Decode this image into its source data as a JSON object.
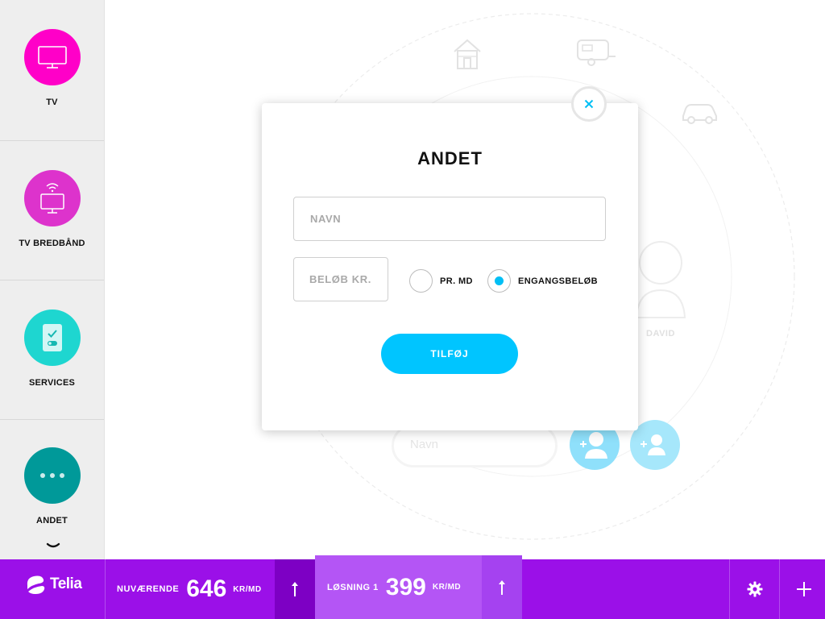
{
  "sidebar": {
    "items": [
      {
        "label": "TV",
        "icon": "tv-icon",
        "color": "#ff00c8"
      },
      {
        "label": "TV BREDBÅND",
        "icon": "wifi-tv-icon",
        "color": "#dd33cc"
      },
      {
        "label": "SERVICES",
        "icon": "phone-check-icon",
        "color": "#1ed6d0"
      },
      {
        "label": "ANDET",
        "icon": "more-icon",
        "color": "#009999"
      }
    ]
  },
  "background": {
    "name_field_placeholder": "Navn",
    "person_name": "DAVID"
  },
  "modal": {
    "title": "ANDET",
    "name_placeholder": "NAVN",
    "amount_placeholder": "BELØB KR.",
    "radio_monthly": "PR. MD",
    "radio_once": "ENGANGSBELØB",
    "selected": "once",
    "submit_label": "TILFØJ"
  },
  "bottombar": {
    "brand": "Telia",
    "current_label": "NUVÆRENDE",
    "current_value": "646",
    "current_unit": "KR/MD",
    "solution_label": "LØSNING 1",
    "solution_value": "399",
    "solution_unit": "KR/MD"
  },
  "colors": {
    "accent": "#00c5ff",
    "brand_purple": "#9b10e8",
    "solution_purple": "#b455f5"
  }
}
